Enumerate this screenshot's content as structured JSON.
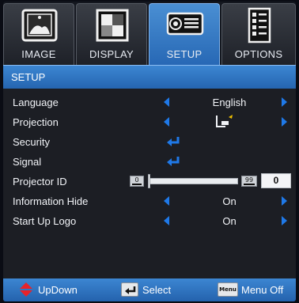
{
  "tabs": [
    {
      "label": "IMAGE",
      "icon": "image-icon",
      "active": false
    },
    {
      "label": "DISPLAY",
      "icon": "display-icon",
      "active": false
    },
    {
      "label": "SETUP",
      "icon": "projector-icon",
      "active": true
    },
    {
      "label": "OPTIONS",
      "icon": "options-checklist-icon",
      "active": false
    }
  ],
  "section": {
    "title": "SETUP"
  },
  "menu": {
    "language": {
      "label": "Language",
      "value": "English"
    },
    "projection": {
      "label": "Projection",
      "value_icon": "front-projection-icon"
    },
    "security": {
      "label": "Security"
    },
    "signal": {
      "label": "Signal"
    },
    "projector_id": {
      "label": "Projector ID",
      "min": "0",
      "max": "99",
      "value": "0",
      "level": 0
    },
    "information_hide": {
      "label": "Information Hide",
      "value": "On"
    },
    "start_up_logo": {
      "label": "Start Up Logo",
      "value": "On"
    }
  },
  "footer": {
    "updown": "UpDown",
    "select": "Select",
    "menu_key": "Menu",
    "menu_off": "Menu Off"
  },
  "colors": {
    "accent": "#2f7ad0",
    "arrow": "#1f79e8",
    "updown_arrow": "#e8232a"
  }
}
